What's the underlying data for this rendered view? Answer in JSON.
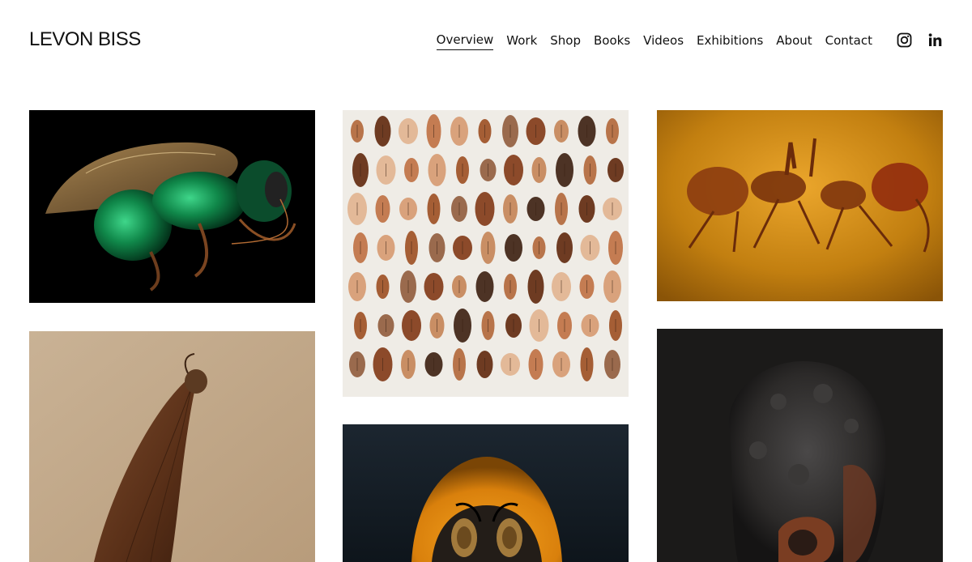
{
  "site": {
    "title": "LEVON BISS"
  },
  "nav": {
    "items": [
      {
        "label": "Overview",
        "active": true
      },
      {
        "label": "Work",
        "active": false
      },
      {
        "label": "Shop",
        "active": false
      },
      {
        "label": "Books",
        "active": false
      },
      {
        "label": "Videos",
        "active": false
      },
      {
        "label": "Exhibitions",
        "active": false
      },
      {
        "label": "About",
        "active": false
      },
      {
        "label": "Contact",
        "active": false
      }
    ]
  },
  "social": {
    "icons": [
      "instagram-icon",
      "linkedin-icon"
    ]
  },
  "colors": {
    "text": "#111111",
    "background": "#ffffff"
  },
  "gallery": {
    "items": [
      {
        "subject": "green metallic wasp",
        "background": "#000000"
      },
      {
        "subject": "collection of seeds",
        "background": "#efece6"
      },
      {
        "subject": "insect in amber",
        "background": "#c98a12"
      },
      {
        "subject": "winged seed",
        "background": "#c7b193"
      },
      {
        "subject": "bumblebee portrait",
        "background": "#151d24"
      },
      {
        "subject": "dark textured seed",
        "background": "#1b1a19"
      }
    ]
  }
}
